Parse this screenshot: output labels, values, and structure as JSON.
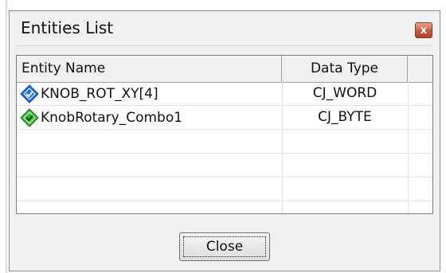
{
  "window": {
    "title": "Entities List",
    "close_glyph": "x"
  },
  "list": {
    "columns": [
      "Entity Name",
      "Data Type"
    ],
    "rows": [
      {
        "name": "KNOB_ROT_XY[4]",
        "type": "CJ_WORD",
        "icon": "blue-diamond-icon",
        "icon_color": "#1f6fe8"
      },
      {
        "name": "KnobRotary_Combo1",
        "type": "CJ_BYTE",
        "icon": "green-diamond-icon",
        "icon_color": "#2db52d"
      }
    ]
  },
  "buttons": {
    "close_label": "Close"
  }
}
